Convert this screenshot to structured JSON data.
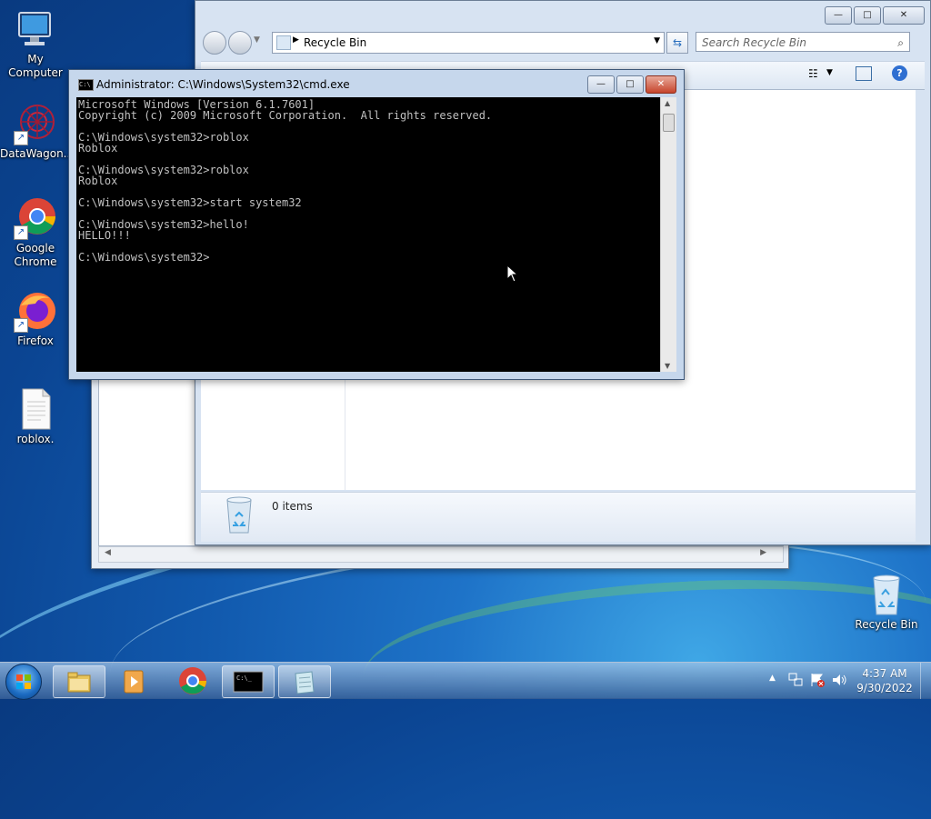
{
  "desktop": {
    "icons": [
      {
        "label": "My Computer"
      },
      {
        "label": "DataWagon..."
      },
      {
        "label": "Google Chrome"
      },
      {
        "label": "Firefox"
      },
      {
        "label": "roblox."
      },
      {
        "label": "Recycle Bin"
      }
    ]
  },
  "explorer": {
    "address": "Recycle Bin",
    "search_placeholder": "Search Recycle Bin",
    "status_count": "0 items"
  },
  "cmd": {
    "title": "Administrator: C:\\Windows\\System32\\cmd.exe",
    "console_lines": "Microsoft Windows [Version 6.1.7601]\nCopyright (c) 2009 Microsoft Corporation.  All rights reserved.\n\nC:\\Windows\\system32>roblox\nRoblox\n\nC:\\Windows\\system32>roblox\nRoblox\n\nC:\\Windows\\system32>start system32\n\nC:\\Windows\\system32>hello!\nHELLO!!!\n\nC:\\Windows\\system32>"
  },
  "taskbar": {
    "time": "4:37 AM",
    "date": "9/30/2022",
    "arrow": "▲"
  },
  "colors": {
    "accent": "#1a5fb4",
    "console_bg": "#000000",
    "console_fg": "#c0c0c0"
  }
}
